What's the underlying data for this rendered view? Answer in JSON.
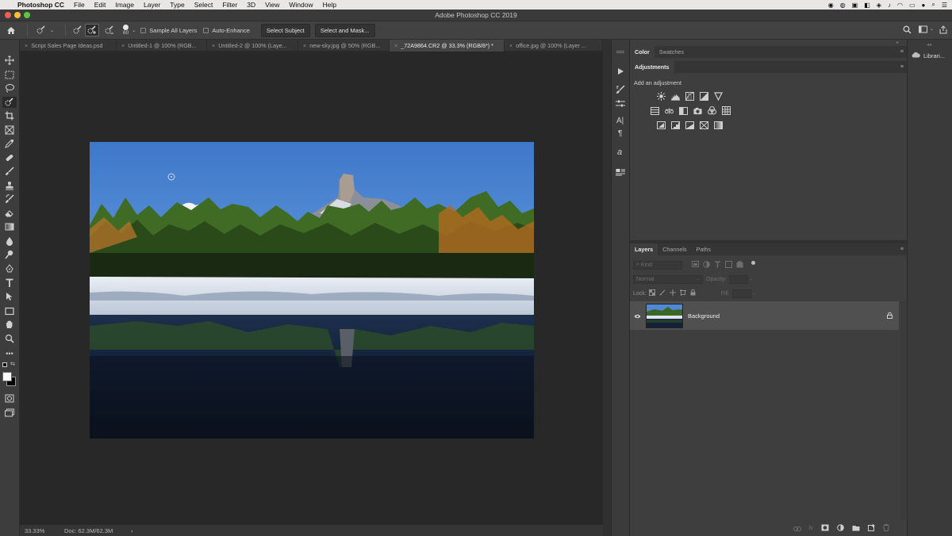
{
  "menubar": {
    "app_name": "Photoshop CC",
    "items": [
      "File",
      "Edit",
      "Image",
      "Layer",
      "Type",
      "Select",
      "Filter",
      "3D",
      "View",
      "Window",
      "Help"
    ]
  },
  "window": {
    "title": "Adobe Photoshop CC 2019"
  },
  "options": {
    "brush_size": "60",
    "sample_all_layers": "Sample All Layers",
    "auto_enhance": "Auto-Enhance",
    "select_subject": "Select Subject",
    "select_and_mask": "Select and Mask..."
  },
  "tabs": [
    {
      "label": "Script Sales Page Ideas.psd",
      "active": false
    },
    {
      "label": "Untitled-1 @ 100% (RGB...",
      "active": false
    },
    {
      "label": "Untitled-2 @ 100% (Laye...",
      "active": false
    },
    {
      "label": "new-sky.jpg @ 50% (RGB...",
      "active": false
    },
    {
      "label": "_72A9864.CR2 @ 33.3% (RGB/8*) *",
      "active": true
    },
    {
      "label": "office.jpg @ 100% (Layer ...",
      "active": false
    }
  ],
  "status": {
    "zoom": "33.33%",
    "doc": "Doc: 62.3M/62.3M",
    "arrow": "›"
  },
  "color_panel": {
    "tabs": [
      "Color",
      "Swatches"
    ]
  },
  "adjustments": {
    "tab": "Adjustments",
    "heading": "Add an adjustment"
  },
  "layers_panel": {
    "tabs": [
      "Layers",
      "Channels",
      "Paths"
    ],
    "kind_placeholder": "Kind",
    "blend_mode": "Normal",
    "opacity_label": "Opacity:",
    "lock_label": "Lock:",
    "fill_label": "Fill:",
    "layers": [
      {
        "name": "Background",
        "visible": true,
        "locked": true
      }
    ]
  },
  "libraries": {
    "label": "Librari..."
  },
  "colors": {
    "accent": "#4d4d4d",
    "selected_layer": "#505050"
  }
}
